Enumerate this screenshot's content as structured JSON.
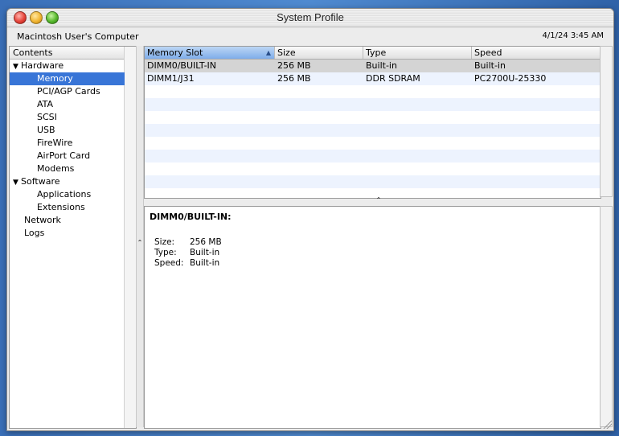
{
  "window": {
    "title": "System Profile"
  },
  "infobar": {
    "computer_name": "Macintosh User's Computer",
    "datetime": "4/1/24 3:45 AM"
  },
  "sidebar": {
    "header": "Contents",
    "items": [
      {
        "label": "Hardware",
        "disclosure": "▼",
        "level": 0
      },
      {
        "label": "Memory",
        "level": 1,
        "selected": true
      },
      {
        "label": "PCI/AGP Cards",
        "level": 1
      },
      {
        "label": "ATA",
        "level": 1
      },
      {
        "label": "SCSI",
        "level": 1
      },
      {
        "label": "USB",
        "level": 1
      },
      {
        "label": "FireWire",
        "level": 1
      },
      {
        "label": "AirPort Card",
        "level": 1
      },
      {
        "label": "Modems",
        "level": 1
      },
      {
        "label": "Software",
        "disclosure": "▼",
        "level": 0
      },
      {
        "label": "Applications",
        "level": 1
      },
      {
        "label": "Extensions",
        "level": 1
      },
      {
        "label": "Network",
        "level": 0
      },
      {
        "label": "Logs",
        "level": 0
      }
    ]
  },
  "table": {
    "columns": [
      "Memory Slot",
      "Size",
      "Type",
      "Speed"
    ],
    "sort_arrow": "▲",
    "rows": [
      [
        "DIMM0/BUILT-IN",
        "256 MB",
        "Built-in",
        "Built-in"
      ],
      [
        "DIMM1/J31",
        "256 MB",
        "DDR SDRAM",
        "PC2700U-25330"
      ]
    ]
  },
  "detail": {
    "title": "DIMM0/BUILT-IN:",
    "fields": [
      {
        "key": "Size:",
        "value": "256 MB"
      },
      {
        "key": "Type:",
        "value": "Built-in"
      },
      {
        "key": "Speed:",
        "value": "Built-in"
      }
    ]
  },
  "grips": {
    "horizontal": "⌃",
    "vertical": "⌃"
  }
}
